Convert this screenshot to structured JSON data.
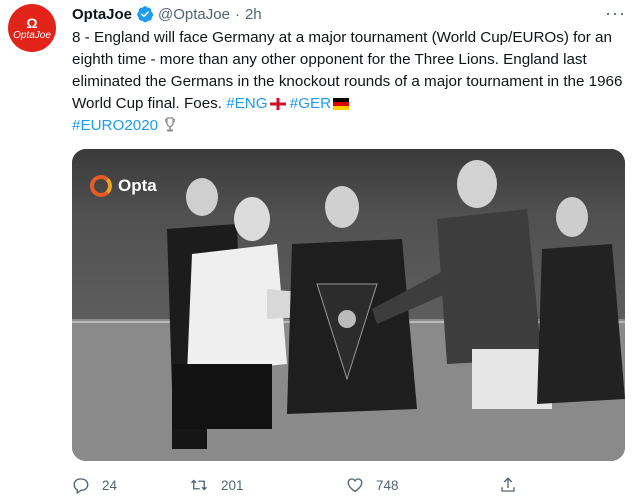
{
  "tweet": {
    "avatar_mark": "Ω",
    "avatar_text": "OptaJoe",
    "author_name": "OptaJoe",
    "handle": "@OptaJoe",
    "separator": "·",
    "time": "2h",
    "more": "···",
    "text_main": "8 - England will face Germany at a major tournament (World Cup/EUROs) for an eighth time - more than any other opponent for the Three Lions. England last eliminated the Germans in the knockout rounds of a major tournament in the 1966 World Cup final. Foes. ",
    "hashtag_eng": "#ENG",
    "hashtag_ger": "#GER",
    "hashtag_euro": "#EURO2020",
    "media_logo_text": "Opta",
    "icons": {
      "verified": "verified-badge-icon",
      "flag_eng": "england-flag-icon",
      "flag_ger": "germany-flag-icon",
      "trophy": "trophy-icon"
    }
  },
  "actions": {
    "reply_count": "24",
    "retweet_count": "201",
    "like_count": "748",
    "icons": [
      "reply-icon",
      "retweet-icon",
      "like-icon",
      "share-icon"
    ]
  },
  "colors": {
    "accent": "#1d9bf0",
    "avatar_bg": "#e2231a",
    "secondary_text": "#536471"
  }
}
